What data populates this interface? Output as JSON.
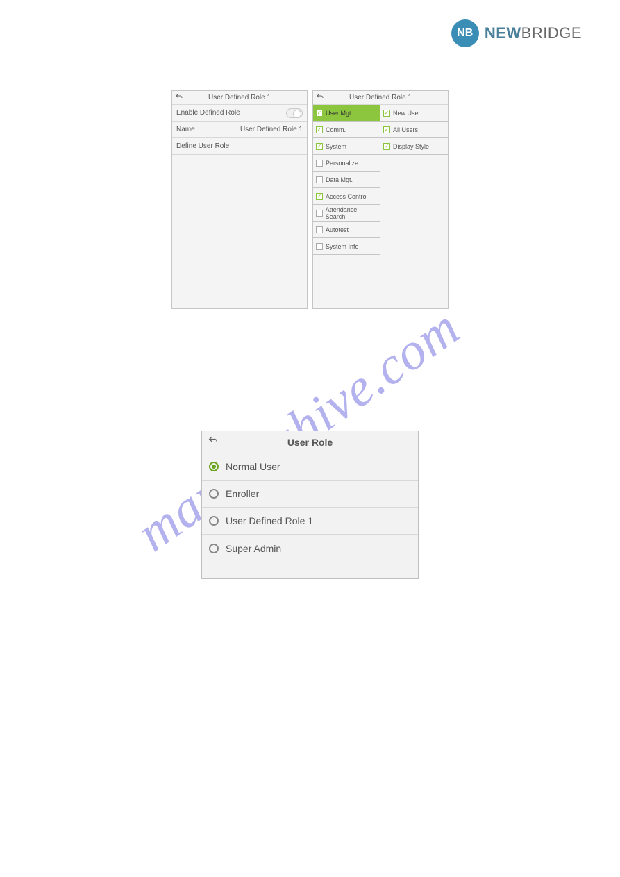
{
  "brand": {
    "badge": "NB",
    "name_bold": "NEW",
    "name_light": "BRIDGE"
  },
  "watermark": "manualshive.com",
  "panel1": {
    "title": "User Defined Role 1",
    "rows": {
      "enable": "Enable Defined Role",
      "name_label": "Name",
      "name_value": "User Defined Role 1",
      "define": "Define User Role"
    }
  },
  "panel2": {
    "title": "User Defined Role 1",
    "left": [
      {
        "label": "User Mgt.",
        "checked": true,
        "highlight": true
      },
      {
        "label": "Comm.",
        "checked": true
      },
      {
        "label": "System",
        "checked": true
      },
      {
        "label": "Personalize",
        "checked": false
      },
      {
        "label": "Data Mgt.",
        "checked": false
      },
      {
        "label": "Access Control",
        "checked": true
      },
      {
        "label": "Attendance Search",
        "checked": false
      },
      {
        "label": "Autotest",
        "checked": false
      },
      {
        "label": "System Info",
        "checked": false
      }
    ],
    "right": [
      {
        "label": "New User",
        "checked": true
      },
      {
        "label": "All Users",
        "checked": true
      },
      {
        "label": "Display Style",
        "checked": true
      }
    ]
  },
  "role_panel": {
    "title": "User Role",
    "options": [
      {
        "label": "Normal User",
        "selected": true
      },
      {
        "label": "Enroller",
        "selected": false
      },
      {
        "label": "User Defined Role 1",
        "selected": false
      },
      {
        "label": "Super Admin",
        "selected": false
      }
    ]
  }
}
